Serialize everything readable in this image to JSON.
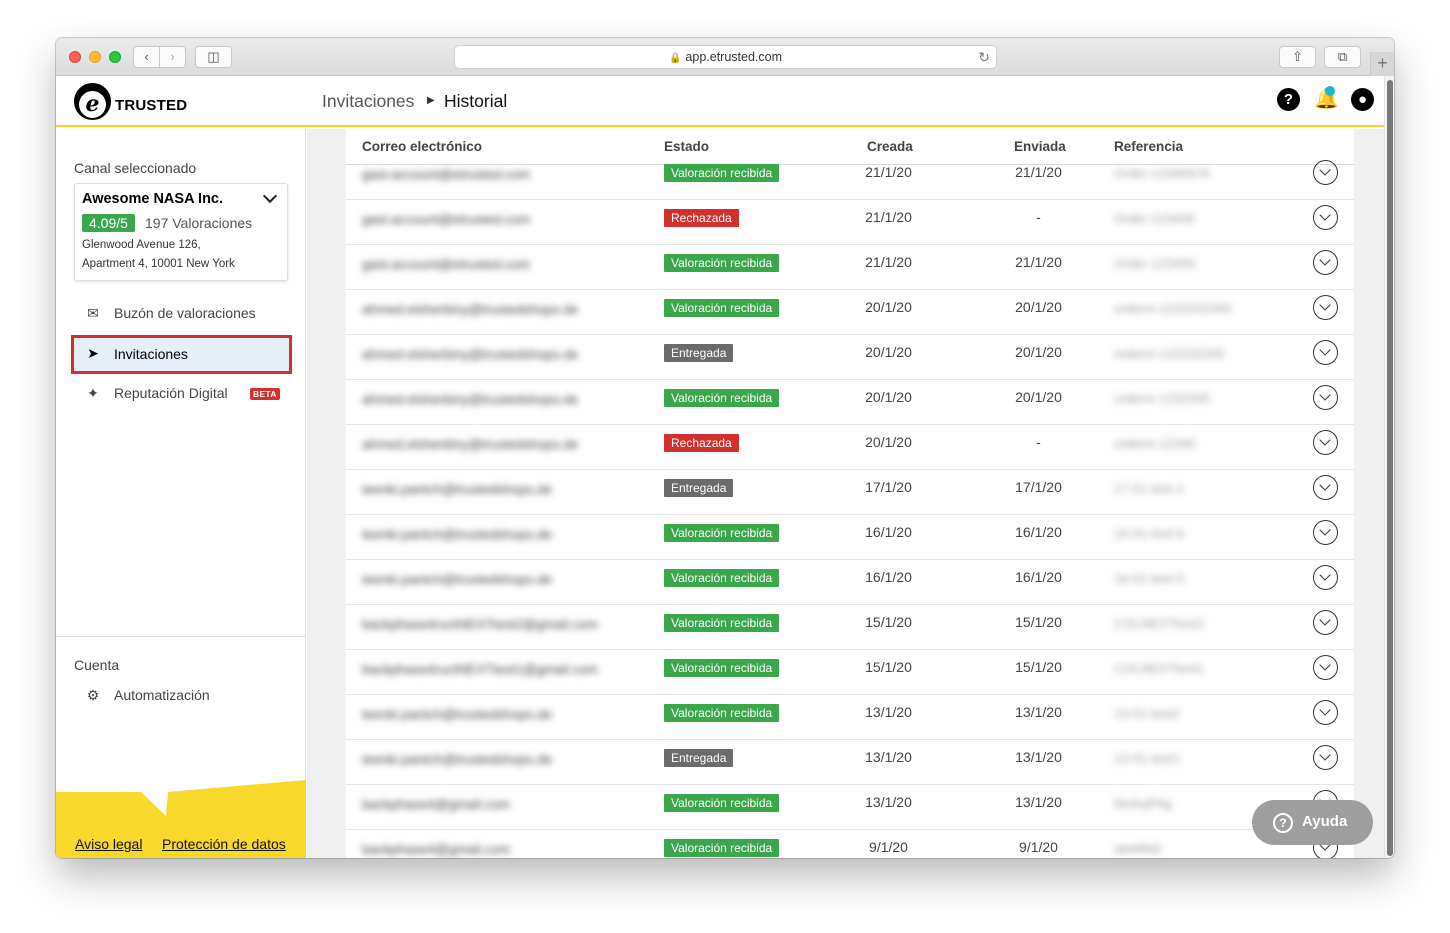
{
  "browser": {
    "url": "app.etrusted.com"
  },
  "header": {
    "logo_letter": "e",
    "logo_text": "TRUSTED",
    "breadcrumb_parent": "Invitaciones",
    "breadcrumb_current": "Historial",
    "help_glyph": "?"
  },
  "sidebar": {
    "channel_label": "Canal seleccionado",
    "channel": {
      "name": "Awesome NASA Inc.",
      "score": "4.09/5",
      "reviews": "197 Valoraciones",
      "address_line1": "Glenwood Avenue 126,",
      "address_line2": "Apartment 4, 10001 New York"
    },
    "items": [
      {
        "label": "Buzón de valoraciones",
        "icon": "inbox-icon"
      },
      {
        "label": "Invitaciones",
        "icon": "send-icon",
        "active": true
      },
      {
        "label": "Reputación Digital",
        "icon": "sparkle-icon",
        "badge": "BETA"
      }
    ],
    "account_label": "Cuenta",
    "account_items": [
      {
        "label": "Automatización",
        "icon": "robot-icon"
      }
    ],
    "footer_links": [
      "Aviso legal",
      "Protección de datos"
    ],
    "accent_color": "#f8d82a"
  },
  "table": {
    "columns": [
      "Correo electrónico",
      "Estado",
      "Creada",
      "Enviada",
      "Referencia"
    ],
    "rows": [
      {
        "email": "gast.account@etrusted.com",
        "status": "Valoración recibida",
        "status_color": "green",
        "created": "21/1/20",
        "sent": "21/1/20",
        "ref": "Order-12345678"
      },
      {
        "email": "gast.account@etrusted.com",
        "status": "Rechazada",
        "status_color": "red",
        "created": "21/1/20",
        "sent": "-",
        "ref": "Order-123456"
      },
      {
        "email": "gast.account@etrusted.com",
        "status": "Valoración recibida",
        "status_color": "green",
        "created": "21/1/20",
        "sent": "21/1/20",
        "ref": "Order-123456"
      },
      {
        "email": "ahmed.elsherbiny@trustedshops.de",
        "status": "Valoración recibida",
        "status_color": "green",
        "created": "20/1/20",
        "sent": "20/1/20",
        "ref": "orderm-1222222345"
      },
      {
        "email": "ahmed.elsherbiny@trustedshops.de",
        "status": "Entregada",
        "status_color": "gray",
        "created": "20/1/20",
        "sent": "20/1/20",
        "ref": "orderm-122232345"
      },
      {
        "email": "ahmed.elsherbiny@trustedshops.de",
        "status": "Valoración recibida",
        "status_color": "green",
        "created": "20/1/20",
        "sent": "20/1/20",
        "ref": "orderm-1232345"
      },
      {
        "email": "ahmed.elsherbiny@trustedshops.de",
        "status": "Rechazada",
        "status_color": "red",
        "created": "20/1/20",
        "sent": "-",
        "ref": "orderm-12345"
      },
      {
        "email": "teenki.pantch@trustedshops.de",
        "status": "Entregada",
        "status_color": "gray",
        "created": "17/1/20",
        "sent": "17/1/20",
        "ref": "17-01-test-1"
      },
      {
        "email": "teenki.pantch@trustedshops.de",
        "status": "Valoración recibida",
        "status_color": "green",
        "created": "16/1/20",
        "sent": "16/1/20",
        "ref": "16-01-test-6"
      },
      {
        "email": "teenki.pantch@trustedshops.de",
        "status": "Valoración recibida",
        "status_color": "green",
        "created": "16/1/20",
        "sent": "16/1/20",
        "ref": "16-01-test-5"
      },
      {
        "email": "backphase4ructNEXTtest2@gmail.com",
        "status": "Valoración recibida",
        "status_color": "green",
        "created": "15/1/20",
        "sent": "15/1/20",
        "ref": "COLNEXTtest2"
      },
      {
        "email": "backphase4ructNEXTtest1@gmail.com",
        "status": "Valoración recibida",
        "status_color": "green",
        "created": "15/1/20",
        "sent": "15/1/20",
        "ref": "COLNEXTtest1"
      },
      {
        "email": "teenki.pantch@trustedshops.de",
        "status": "Valoración recibida",
        "status_color": "green",
        "created": "13/1/20",
        "sent": "13/1/20",
        "ref": "13-01-test2"
      },
      {
        "email": "teenki.pantch@trustedshops.de",
        "status": "Entregada",
        "status_color": "gray",
        "created": "13/1/20",
        "sent": "13/1/20",
        "ref": "13-01-test1"
      },
      {
        "email": "backphase4@gmail.com",
        "status": "Valoración recibida",
        "status_color": "green",
        "created": "13/1/20",
        "sent": "13/1/20",
        "ref": "MxAxjPkg"
      },
      {
        "email": "backphase4@gmail.com",
        "status": "Valoración recibida",
        "status_color": "green",
        "created": "9/1/20",
        "sent": "9/1/20",
        "ref": "abd4fe8"
      }
    ]
  },
  "help_widget": {
    "label": "Ayuda"
  }
}
